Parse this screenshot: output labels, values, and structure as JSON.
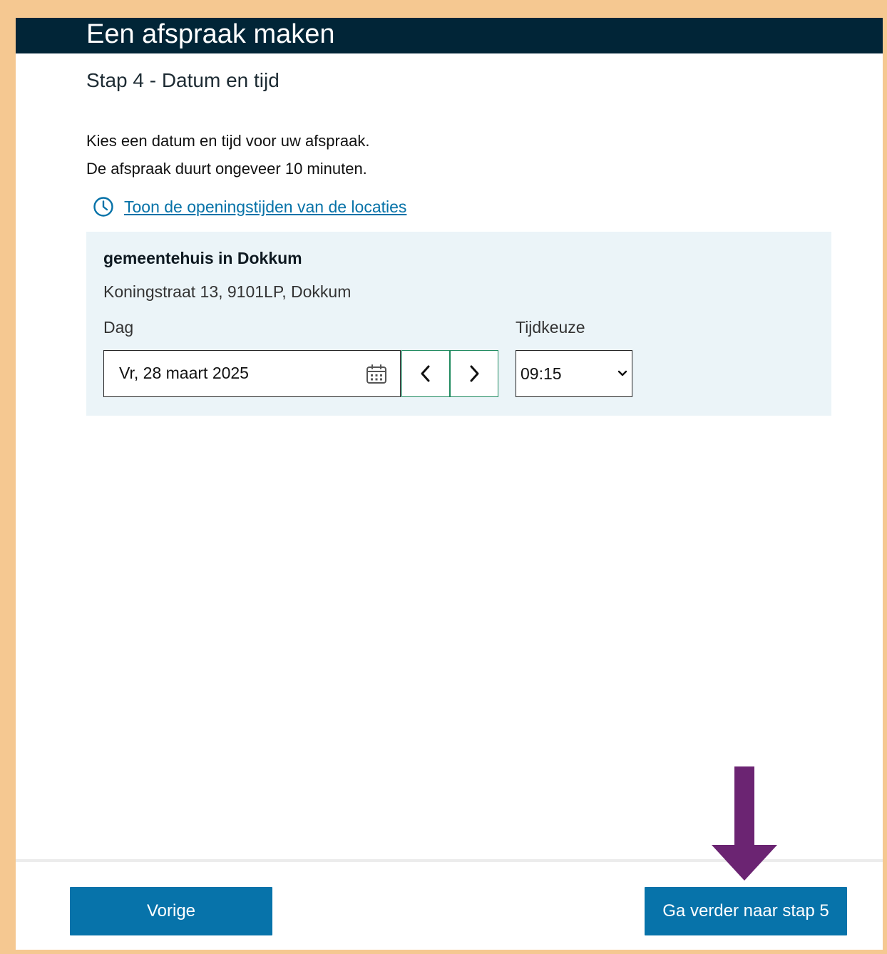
{
  "header": {
    "title": "Een afspraak maken"
  },
  "step": {
    "title": "Stap 4 - Datum en tijd"
  },
  "intro": {
    "line1": "Kies een datum en tijd voor uw afspraak.",
    "line2": "De afspraak duurt ongeveer 10 minuten."
  },
  "hours_link": {
    "icon": "clock-icon",
    "label": "Toon de openingstijden van de locaties"
  },
  "location": {
    "name": "gemeentehuis in Dokkum",
    "address": "Koningstraat 13, 9101LP, Dokkum",
    "day_label": "Dag",
    "day_value": "Vr, 28 maart 2025",
    "day_icon": "calendar-icon",
    "prev_icon": "chevron-left-icon",
    "next_icon": "chevron-right-icon",
    "time_label": "Tijdkeuze",
    "time_value": "09:15",
    "time_icon": "chevron-down-icon"
  },
  "footer": {
    "prev_label": "Vorige",
    "next_label": "Ga verder naar stap 5"
  },
  "colors": {
    "outer_border": "#f5c891",
    "header_bg": "#012537",
    "panel_bg": "#ebf4f8",
    "link": "#0672a8",
    "nav_border": "#1f8a5f",
    "button_bg": "#0773aa",
    "annotation_arrow": "#6b2472"
  }
}
